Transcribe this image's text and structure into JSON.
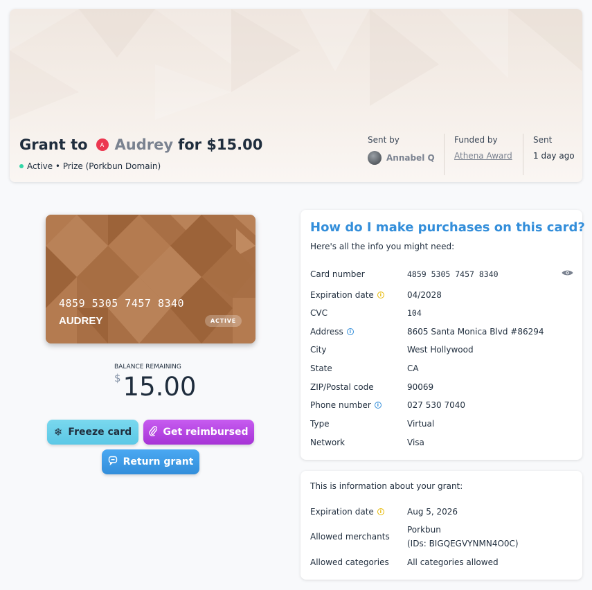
{
  "header": {
    "prefix": "Grant to",
    "recipient_initial": "A",
    "recipient": "Audrey",
    "amount_text": "for $15.00",
    "status": "Active • Prize (Porkbun Domain)",
    "sent_by_label": "Sent by",
    "sent_by": "Annabel Q",
    "funded_by_label": "Funded by",
    "funded_by": "Athena Award",
    "sent_label": "Sent",
    "sent": "1 day ago"
  },
  "card": {
    "number": "4859 5305 7457 8340",
    "name": "AUDREY",
    "badge": "ACTIVE"
  },
  "balance": {
    "label": "BALANCE REMAINING",
    "currency": "$",
    "amount": "15.00"
  },
  "buttons": {
    "freeze": "Freeze card",
    "reimburse": "Get reimbursed",
    "return": "Return grant"
  },
  "info_panel": {
    "title": "How do I make purchases on this card?",
    "subtitle": "Here's all the info you might need:",
    "rows": [
      {
        "key": "Card number",
        "value": "4859 5305 7457 8340"
      },
      {
        "key": "Expiration date",
        "value": "04/2028"
      },
      {
        "key": "CVC",
        "value": "104"
      },
      {
        "key": "Address",
        "value": "8605 Santa Monica Blvd #86294"
      },
      {
        "key": "City",
        "value": "West Hollywood"
      },
      {
        "key": "State",
        "value": "CA"
      },
      {
        "key": "ZIP/Postal code",
        "value": "90069"
      },
      {
        "key": "Phone number",
        "value": "027 530 7040"
      },
      {
        "key": "Type",
        "value": "Virtual"
      },
      {
        "key": "Network",
        "value": "Visa"
      }
    ]
  },
  "grant_panel": {
    "subtitle": "This is information about your grant:",
    "rows": [
      {
        "key": "Expiration date",
        "value": "Aug 5, 2026"
      },
      {
        "key": "Allowed merchants",
        "value": "Porkbun",
        "value2": "(IDs: BIGQEGVYNMN4O0C)"
      },
      {
        "key": "Allowed categories",
        "value": "All categories allowed"
      }
    ]
  },
  "colors": {
    "accent_blue": "#338eda",
    "status_green": "#33d6a6",
    "avatar_red": "#ec3750",
    "card_brown": "#a86f45"
  },
  "icons": {
    "freeze": "snowflake-icon",
    "reimburse": "paperclip-icon",
    "return": "chat-icon",
    "reveal": "eye-icon",
    "hint": "info-icon"
  }
}
